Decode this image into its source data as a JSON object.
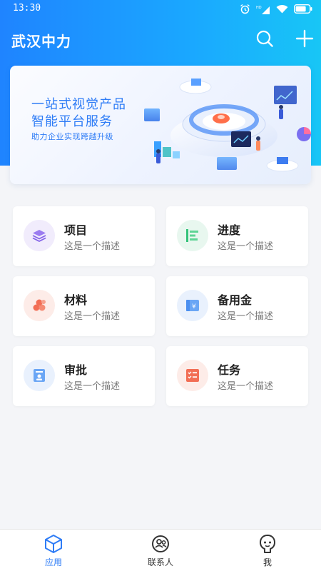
{
  "status_bar": {
    "time": "13:30",
    "network_label": "HD"
  },
  "app_bar": {
    "title": "武汉中力"
  },
  "banner": {
    "title_line1": "一站式视觉产品",
    "title_line2": "智能平台服务",
    "subtitle": "助力企业实现跨越升级"
  },
  "modules": [
    {
      "title": "项目",
      "desc": "这是一个描述",
      "icon": "layers-icon",
      "color": "#8d6ee8"
    },
    {
      "title": "进度",
      "desc": "这是一个描述",
      "icon": "progress-bars-icon",
      "color": "#34c27a"
    },
    {
      "title": "材料",
      "desc": "这是一个描述",
      "icon": "materials-icon",
      "color": "#f26e55"
    },
    {
      "title": "备用金",
      "desc": "这是一个描述",
      "icon": "reserve-fund-icon",
      "color": "#4b8ff0"
    },
    {
      "title": "审批",
      "desc": "这是一个描述",
      "icon": "approval-icon",
      "color": "#4b8ff0"
    },
    {
      "title": "任务",
      "desc": "这是一个描述",
      "icon": "task-list-icon",
      "color": "#f26e55"
    }
  ],
  "tabbar": {
    "tabs": [
      {
        "label": "应用",
        "icon": "app-cube-icon",
        "active": true
      },
      {
        "label": "联系人",
        "icon": "contacts-icon",
        "active": false
      },
      {
        "label": "我",
        "icon": "profile-icon",
        "active": false
      }
    ]
  },
  "colors": {
    "primary": "#2e7cf6",
    "header_start": "#1f84ff",
    "header_end": "#18c6f6"
  }
}
